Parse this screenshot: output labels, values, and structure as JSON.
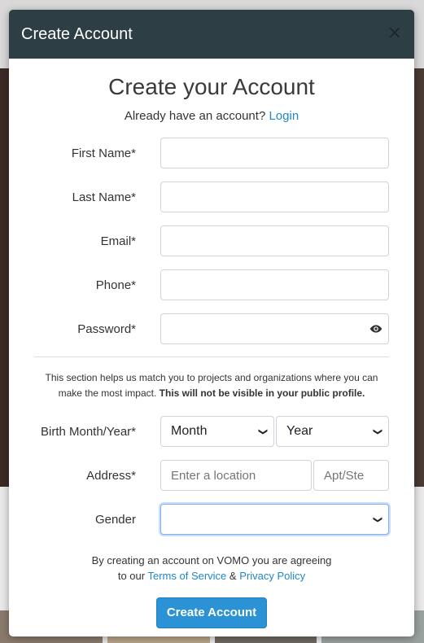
{
  "modal": {
    "title": "Create Account",
    "close_icon": "×"
  },
  "form": {
    "heading": "Create your Account",
    "login_prompt": "Already have an account?",
    "login_link": "Login",
    "fields": {
      "first_name": {
        "label": "First Name*",
        "value": ""
      },
      "last_name": {
        "label": "Last Name*",
        "value": ""
      },
      "email": {
        "label": "Email*",
        "value": ""
      },
      "phone": {
        "label": "Phone*",
        "value": ""
      },
      "password": {
        "label": "Password*",
        "value": ""
      }
    },
    "info_text": "This section helps us match you to projects and organizations where you can make the most impact.",
    "info_bold": "This will not be visible in your public profile.",
    "birth": {
      "label": "Birth Month/Year*",
      "month": "Month",
      "year": "Year"
    },
    "address": {
      "label": "Address*",
      "placeholder": "Enter a location",
      "apt_placeholder": "Apt/Ste"
    },
    "gender": {
      "label": "Gender",
      "value": ""
    },
    "agree": {
      "prefix": "By creating an account on VOMO you are agreeing",
      "to_our": "to our",
      "terms": "Terms of Service",
      "amp": "&",
      "privacy": "Privacy Policy"
    },
    "submit_label": "Create Account"
  },
  "colors": {
    "header_bg": "#2d3e45",
    "accent": "#2b93d5",
    "link": "#1e88c7"
  }
}
